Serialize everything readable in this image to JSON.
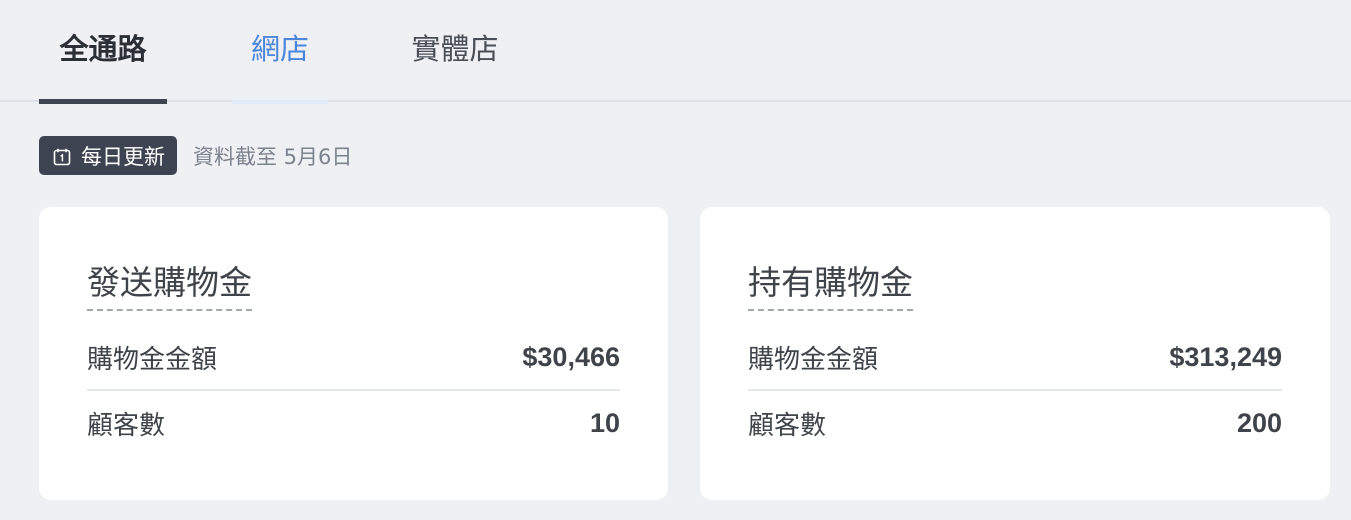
{
  "tabs": [
    {
      "label": "全通路",
      "state": "active"
    },
    {
      "label": "網店",
      "state": "hover"
    },
    {
      "label": "實體店",
      "state": "normal"
    }
  ],
  "update": {
    "badge_icon": "calendar-icon",
    "badge_label": "每日更新",
    "as_of_text": "資料截至 5月6日"
  },
  "cards": [
    {
      "title": "發送購物金",
      "rows": [
        {
          "label": "購物金金額",
          "value": "$30,466"
        },
        {
          "label": "顧客數",
          "value": "10"
        }
      ]
    },
    {
      "title": "持有購物金",
      "rows": [
        {
          "label": "購物金金額",
          "value": "$313,249"
        },
        {
          "label": "顧客數",
          "value": "200"
        }
      ]
    }
  ],
  "colors": {
    "background": "#eef0f3",
    "active_tab_indicator": "#3d4350",
    "hover_tab_text": "#4c86dc",
    "badge_background": "#3d4350"
  }
}
